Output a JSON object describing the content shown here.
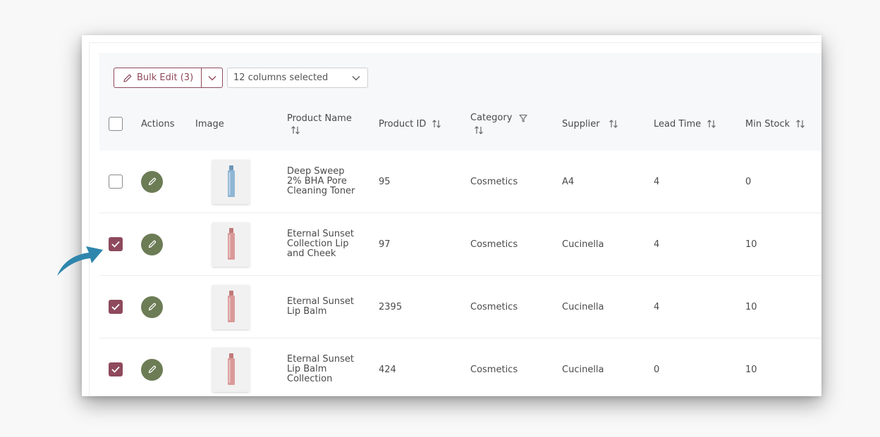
{
  "toolbar": {
    "bulk_edit_label": "Bulk Edit (3)",
    "columns_select_value": "12 columns selected"
  },
  "columns": {
    "actions": "Actions",
    "image": "Image",
    "product_name": "Product Name",
    "product_id": "Product ID",
    "category": "Category",
    "supplier": "Supplier",
    "lead_time": "Lead Time",
    "min_stock": "Min Stock"
  },
  "rows": [
    {
      "checked": false,
      "name_lines": [
        "Deep Sweep",
        "2% BHA Pore",
        "Cleaning Toner"
      ],
      "product_id": "95",
      "category": "Cosmetics",
      "supplier": "A4",
      "lead_time": "4",
      "min_stock": "0",
      "image": "blue-toner-bottle"
    },
    {
      "checked": true,
      "name_lines": [
        "Eternal Sunset",
        "Collection Lip",
        "and Cheek"
      ],
      "product_id": "97",
      "category": "Cosmetics",
      "supplier": "Cucinella",
      "lead_time": "4",
      "min_stock": "10",
      "image": "pink-bottle"
    },
    {
      "checked": true,
      "name_lines": [
        "Eternal Sunset",
        "Lip Balm"
      ],
      "product_id": "2395",
      "category": "Cosmetics",
      "supplier": "Cucinella",
      "lead_time": "4",
      "min_stock": "10",
      "image": "pink-bottle"
    },
    {
      "checked": true,
      "name_lines": [
        "Eternal Sunset",
        "Lip Balm",
        "Collection"
      ],
      "product_id": "424",
      "category": "Cosmetics",
      "supplier": "Cucinella",
      "lead_time": "0",
      "min_stock": "10",
      "image": "pink-bottle"
    }
  ],
  "colors": {
    "accent": "#8e4a5c",
    "edit_button": "#6c7c55",
    "arrow": "#2f86ad"
  },
  "icons": {
    "bulk_edit": "pencil-icon",
    "dropdown": "chevron-down-icon",
    "sort": "sort-icon",
    "filter": "filter-icon",
    "edit": "pencil-icon",
    "check": "check-icon"
  }
}
